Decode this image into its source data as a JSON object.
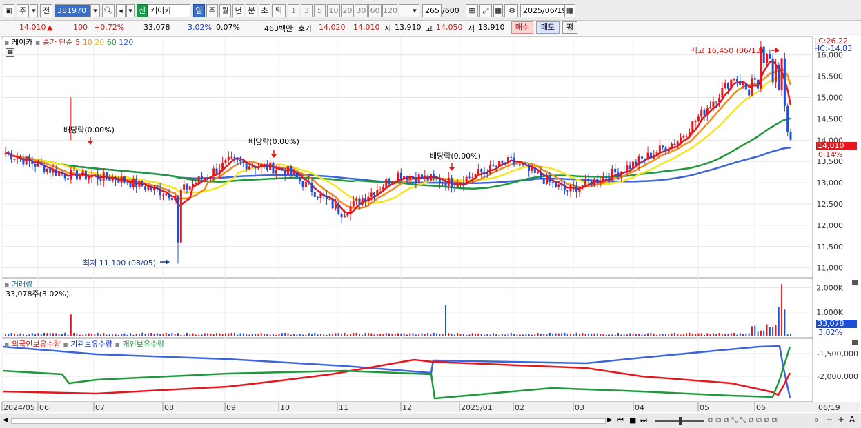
{
  "toolbar": {
    "code": "381970",
    "tabs": [
      "주",
      "전"
    ],
    "badge": "신",
    "name": "케이카",
    "periods": [
      "일",
      "주",
      "월",
      "년",
      "분",
      "초",
      "틱"
    ],
    "intervals": [
      "1",
      "3",
      "5",
      "10",
      "20",
      "30",
      "60",
      "120"
    ],
    "count": "265",
    "count_max": "/600",
    "date": "2025/06/19"
  },
  "quote": {
    "price": "14,010",
    "arrow": "▲",
    "change": "100",
    "pct": "+0.72%",
    "volume": "33,078",
    "vol_ratio": "3.02%",
    "turnover": "0.07%",
    "amount": "463백만",
    "bid_label": "호가",
    "ask": "14,020",
    "bid": "14,010",
    "open_label": "시",
    "open": "13,910",
    "high_label": "고",
    "high": "14,050",
    "low_label": "저",
    "low": "13,910",
    "buy": "매수",
    "sell": "매도",
    "even": "평"
  },
  "price_panel": {
    "legend_name": "케이카",
    "legend_ma": "종가 단순",
    "ma_periods": [
      "5",
      "10",
      "20",
      "60",
      "120"
    ],
    "lc": "LC:26.22",
    "hc": "HC:-14.83",
    "high_note": "최고 16,450 (06/13)",
    "low_note": "최저 11,100 (08/05)",
    "div1": "배당락(0.00%)",
    "div2": "배당락(0.00%)",
    "div3": "배당락(0.00%)",
    "cur_price": "14,010",
    "cur_pct": "0.14%",
    "yticks": [
      "16,000",
      "15,500",
      "15,000",
      "14,500",
      "14,000",
      "13,500",
      "13,000",
      "12,500",
      "12,000",
      "11,500",
      "11,000"
    ]
  },
  "volume_panel": {
    "title": "거래량",
    "current": "33,078주(3.02%)",
    "yticks": [
      "2,000K",
      "1,000K"
    ],
    "cur_value": "33,078",
    "cur_pct": "3.02%"
  },
  "holding_panel": {
    "legend": [
      "외국인보유수량",
      "기관보유수량",
      "개인보유수량"
    ],
    "yticks": [
      "-1,500,000",
      "-2,000,000"
    ]
  },
  "x_axis": [
    "2024/05",
    "06",
    "07",
    "08",
    "09",
    "10",
    "11",
    "12",
    "2025/01",
    "02",
    "03",
    "04",
    "05",
    "06",
    "06/19"
  ],
  "colors": {
    "up": "#e8161a",
    "down": "#1e4fd8",
    "ma5": "#e8161a",
    "ma10": "#f08c1e",
    "ma20": "#f5e61e",
    "ma60": "#1e9a3c",
    "ma120": "#3c64dc"
  },
  "chart_data": {
    "type": "candlestick",
    "x_range": [
      "2024/05",
      "2025/06/19"
    ],
    "price_ylim": [
      10800,
      16400
    ],
    "highlights": {
      "high": 16450,
      "high_date": "06/13",
      "low": 11100,
      "low_date": "08/05"
    },
    "monthly_close_approx": [
      {
        "x": "2024/05",
        "close": 13700
      },
      {
        "x": "06",
        "close": 13200
      },
      {
        "x": "07",
        "close": 13100
      },
      {
        "x": "08",
        "close": 12700
      },
      {
        "x": "09",
        "close": 13500
      },
      {
        "x": "10",
        "close": 13300
      },
      {
        "x": "11",
        "close": 12300
      },
      {
        "x": "12",
        "close": 13200
      },
      {
        "x": "2025/01",
        "close": 13000
      },
      {
        "x": "02",
        "close": 13500
      },
      {
        "x": "03",
        "close": 12800
      },
      {
        "x": "04",
        "close": 13300
      },
      {
        "x": "05",
        "close": 14000
      },
      {
        "x": "06",
        "close": 15500
      },
      {
        "x": "06/19",
        "close": 14010
      }
    ],
    "volume_ylim": [
      0,
      2300000
    ]
  }
}
